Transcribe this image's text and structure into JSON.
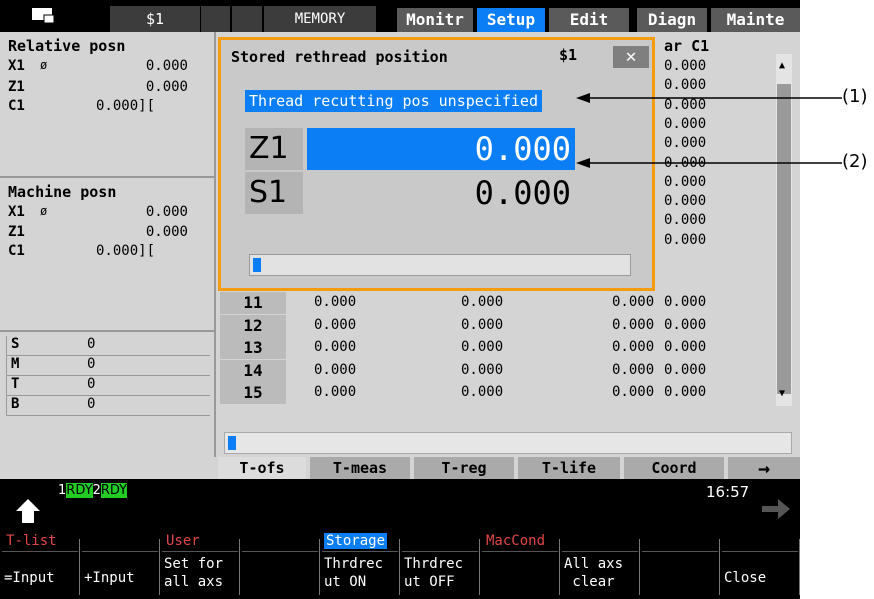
{
  "topbar": {
    "system": "$1",
    "mode": "MEMORY",
    "tabs": [
      "Monitr",
      "Setup",
      "Edit",
      "Diagn",
      "Mainte"
    ],
    "active_tab": "Setup"
  },
  "relative": {
    "title": "Relative posn",
    "rows": [
      {
        "axis": "X1",
        "sym": "ø",
        "value": "0.000"
      },
      {
        "axis": "Z1",
        "sym": "",
        "value": "0.000"
      },
      {
        "axis": "C1",
        "sym": "",
        "value": "0.000]["
      }
    ]
  },
  "machine": {
    "title": "Machine posn",
    "rows": [
      {
        "axis": "X1",
        "sym": "ø",
        "value": "0.000"
      },
      {
        "axis": "Z1",
        "sym": "",
        "value": "0.000"
      },
      {
        "axis": "C1",
        "sym": "",
        "value": "0.000]["
      }
    ]
  },
  "smtb": [
    {
      "label": "S",
      "value": "0"
    },
    {
      "label": "M",
      "value": "0"
    },
    {
      "label": "T",
      "value": "0"
    },
    {
      "label": "B",
      "value": "0"
    }
  ],
  "table": {
    "col4_header": "ar C1",
    "col4_values": [
      "0.000",
      "0.000",
      "0.000",
      "0.000",
      "0.000",
      "0.000",
      "0.000",
      "0.000",
      "0.000",
      "0.000"
    ],
    "rows": [
      {
        "num": "11",
        "c1": "0.000",
        "c2": "0.000",
        "c3": "0.000"
      },
      {
        "num": "12",
        "c1": "0.000",
        "c2": "0.000",
        "c3": "0.000"
      },
      {
        "num": "13",
        "c1": "0.000",
        "c2": "0.000",
        "c3": "0.000"
      },
      {
        "num": "14",
        "c1": "0.000",
        "c2": "0.000",
        "c3": "0.000"
      },
      {
        "num": "15",
        "c1": "0.000",
        "c2": "0.000",
        "c3": "0.000"
      }
    ]
  },
  "dialog": {
    "title": "Stored rethread position",
    "system": "$1",
    "close": "✕",
    "message": "Thread recutting pos unspecified",
    "rows": [
      {
        "label": "Z1",
        "value": "0.000"
      },
      {
        "label": "S1",
        "value": "0.000"
      }
    ],
    "progress": 0.02
  },
  "tabs": [
    "T-ofs",
    "T-meas",
    "T-reg",
    "T-life",
    "Coord",
    "→"
  ],
  "status": {
    "rdy1": "RDY",
    "rdy1_num": "1",
    "rdy2": "RDY",
    "rdy2_num": "2",
    "time": "16:57"
  },
  "softkeys": [
    {
      "top": "T-list",
      "bottom": "=Input",
      "top_active": false
    },
    {
      "top": "",
      "bottom": "+Input",
      "top_active": false
    },
    {
      "top": "User",
      "bottom": "Set for\nall axs",
      "top_active": false
    },
    {
      "top": "",
      "bottom": "",
      "top_active": false
    },
    {
      "top": "Storage",
      "bottom": "Thrdrec\nut ON",
      "top_active": true
    },
    {
      "top": "",
      "bottom": "Thrdrec\nut OFF",
      "top_active": false
    },
    {
      "top": "MacCond",
      "bottom": "",
      "top_active": false
    },
    {
      "top": "",
      "bottom": "All axs\n clear",
      "top_active": false
    },
    {
      "top": "",
      "bottom": "",
      "top_active": false
    },
    {
      "top": "",
      "bottom": "Close",
      "top_active": false
    }
  ],
  "callouts": [
    "(1)",
    "(2)"
  ],
  "colors": {
    "accent": "#0c7ef5",
    "highlight_border": "#f39c12",
    "ready": "#22cc22"
  }
}
